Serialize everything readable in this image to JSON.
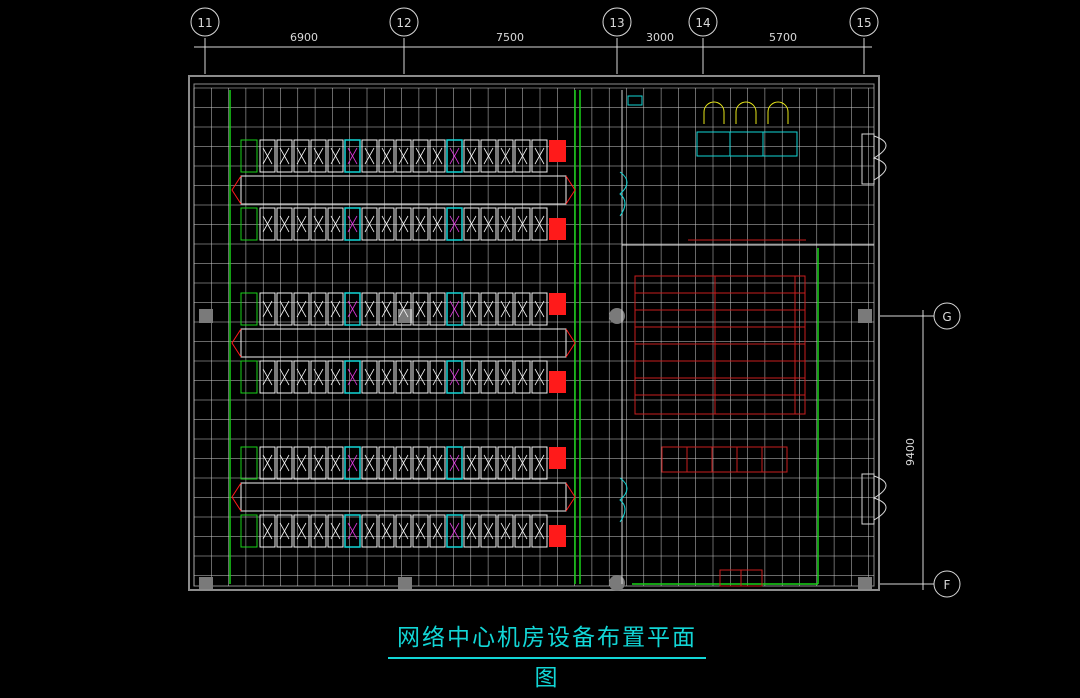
{
  "title": "网络中心机房设备布置平面图",
  "axes": {
    "columns": [
      "11",
      "12",
      "13",
      "14",
      "15"
    ],
    "rows": [
      "G",
      "F"
    ]
  },
  "dimensions": {
    "top": [
      "6900",
      "7500",
      "3000",
      "5700"
    ],
    "right": "9400"
  },
  "colors": {
    "background": "#000000",
    "wall": "#8c8c8c",
    "grid": "#d9d9d9",
    "green": "#19d219",
    "cyan": "#12d6d6",
    "red": "#ff1a1a",
    "darkred": "#c81e1e",
    "yellow": "#e6e619",
    "magenta": "#d838d8",
    "white": "#f2f2f2"
  }
}
